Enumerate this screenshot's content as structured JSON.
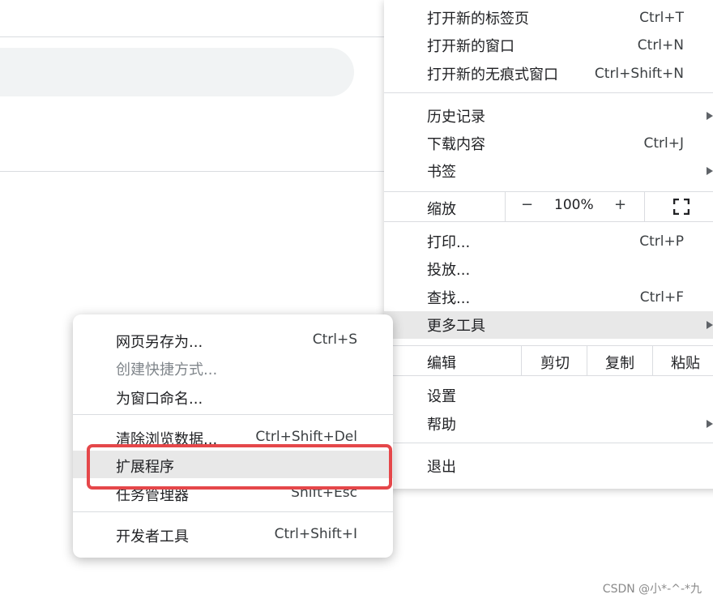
{
  "main_menu": {
    "items": {
      "new_tab": {
        "label": "打开新的标签页",
        "shortcut": "Ctrl+T"
      },
      "new_window": {
        "label": "打开新的窗口",
        "shortcut": "Ctrl+N"
      },
      "new_incognito": {
        "label": "打开新的无痕式窗口",
        "shortcut": "Ctrl+Shift+N"
      },
      "history": {
        "label": "历史记录"
      },
      "downloads": {
        "label": "下载内容",
        "shortcut": "Ctrl+J"
      },
      "bookmarks": {
        "label": "书签"
      },
      "print": {
        "label": "打印...",
        "shortcut": "Ctrl+P"
      },
      "cast": {
        "label": "投放..."
      },
      "find": {
        "label": "查找...",
        "shortcut": "Ctrl+F"
      },
      "more_tools": {
        "label": "更多工具"
      },
      "settings": {
        "label": "设置"
      },
      "help": {
        "label": "帮助"
      },
      "exit": {
        "label": "退出"
      }
    },
    "zoom": {
      "label": "缩放",
      "minus": "−",
      "value": "100%",
      "plus": "+"
    },
    "edit": {
      "label": "编辑",
      "cut": "剪切",
      "copy": "复制",
      "paste": "粘贴"
    }
  },
  "sub_menu": {
    "items": {
      "save_page": {
        "label": "网页另存为...",
        "shortcut": "Ctrl+S"
      },
      "create_shortcut": {
        "label": "创建快捷方式..."
      },
      "name_window": {
        "label": "为窗口命名..."
      },
      "clear_data": {
        "label": "清除浏览数据...",
        "shortcut": "Ctrl+Shift+Del"
      },
      "extensions": {
        "label": "扩展程序"
      },
      "task_manager": {
        "label": "任务管理器",
        "shortcut": "Shift+Esc"
      },
      "dev_tools": {
        "label": "开发者工具",
        "shortcut": "Ctrl+Shift+I"
      }
    }
  },
  "watermark": "CSDN @小*-^-*九",
  "colors": {
    "highlight": "#e8e8e8",
    "annotation_box": "#e5474a",
    "separator": "#dadce0"
  },
  "icons": {
    "submenu_arrow": "triangle-right-icon",
    "fullscreen": "fullscreen-icon"
  }
}
